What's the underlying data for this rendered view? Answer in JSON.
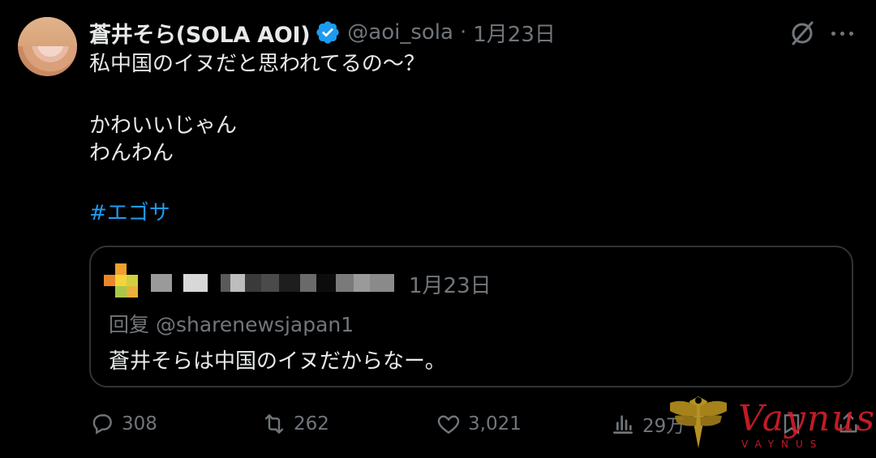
{
  "tweet": {
    "display_name": "蒼井そら(SOLA AOI)",
    "handle": "@aoi_sola",
    "separator": "·",
    "date": "1月23日",
    "lines": [
      "私中国のイヌだと思われてるの〜？",
      "かわいいじゃん",
      "わんわん"
    ],
    "hashtag": "#エゴサ"
  },
  "quote": {
    "date": "1月23日",
    "reply_prefix": "回复 @sharenewsjapan1",
    "text": "蒼井そらは中国のイヌだからなー。"
  },
  "actions": {
    "replies": "308",
    "retweets": "262",
    "likes": "3,021",
    "views": "29万"
  },
  "watermark": {
    "script": "Vaynus",
    "small": "VAYNUS"
  },
  "colors": {
    "accent": "#1d9bf0",
    "muted": "#71767b",
    "border": "#2f3336",
    "watermark": "#d61f2a"
  }
}
